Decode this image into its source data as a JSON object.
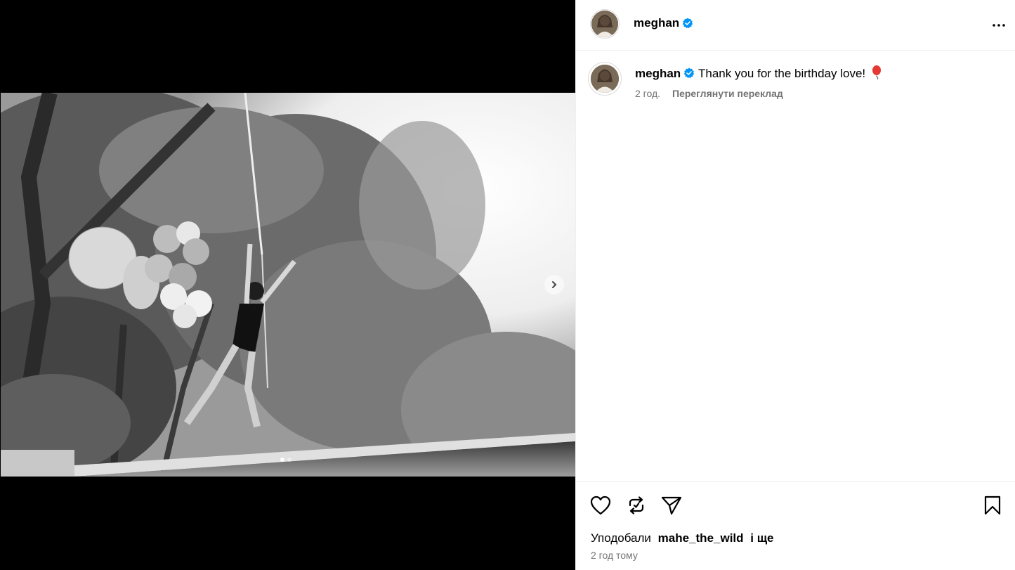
{
  "post": {
    "username": "meghan",
    "verified": true,
    "caption": "Thank you for the birthday love! 🎈",
    "caption_text": "Thank you for the birthday love!",
    "caption_emoji": "balloon-icon",
    "relative_time": "2 год.",
    "see_translation": "Переглянути переклад",
    "liked_by_prefix": "Уподобали",
    "liked_by_user": "mahe_the_wild",
    "liked_by_suffix": "і ще",
    "posted_ago": "2 год тому"
  },
  "media": {
    "slide_count": 2,
    "current_slide": 1,
    "next_icon": "chevron-right-icon"
  },
  "colors": {
    "verified_blue": "#0095f6",
    "secondary_text": "#737373",
    "divider": "#efefef"
  },
  "actions": {
    "like_icon": "heart-icon",
    "repost_icon": "repost-icon",
    "share_icon": "send-icon",
    "save_icon": "bookmark-icon",
    "more_icon": "more-horizontal-icon"
  }
}
